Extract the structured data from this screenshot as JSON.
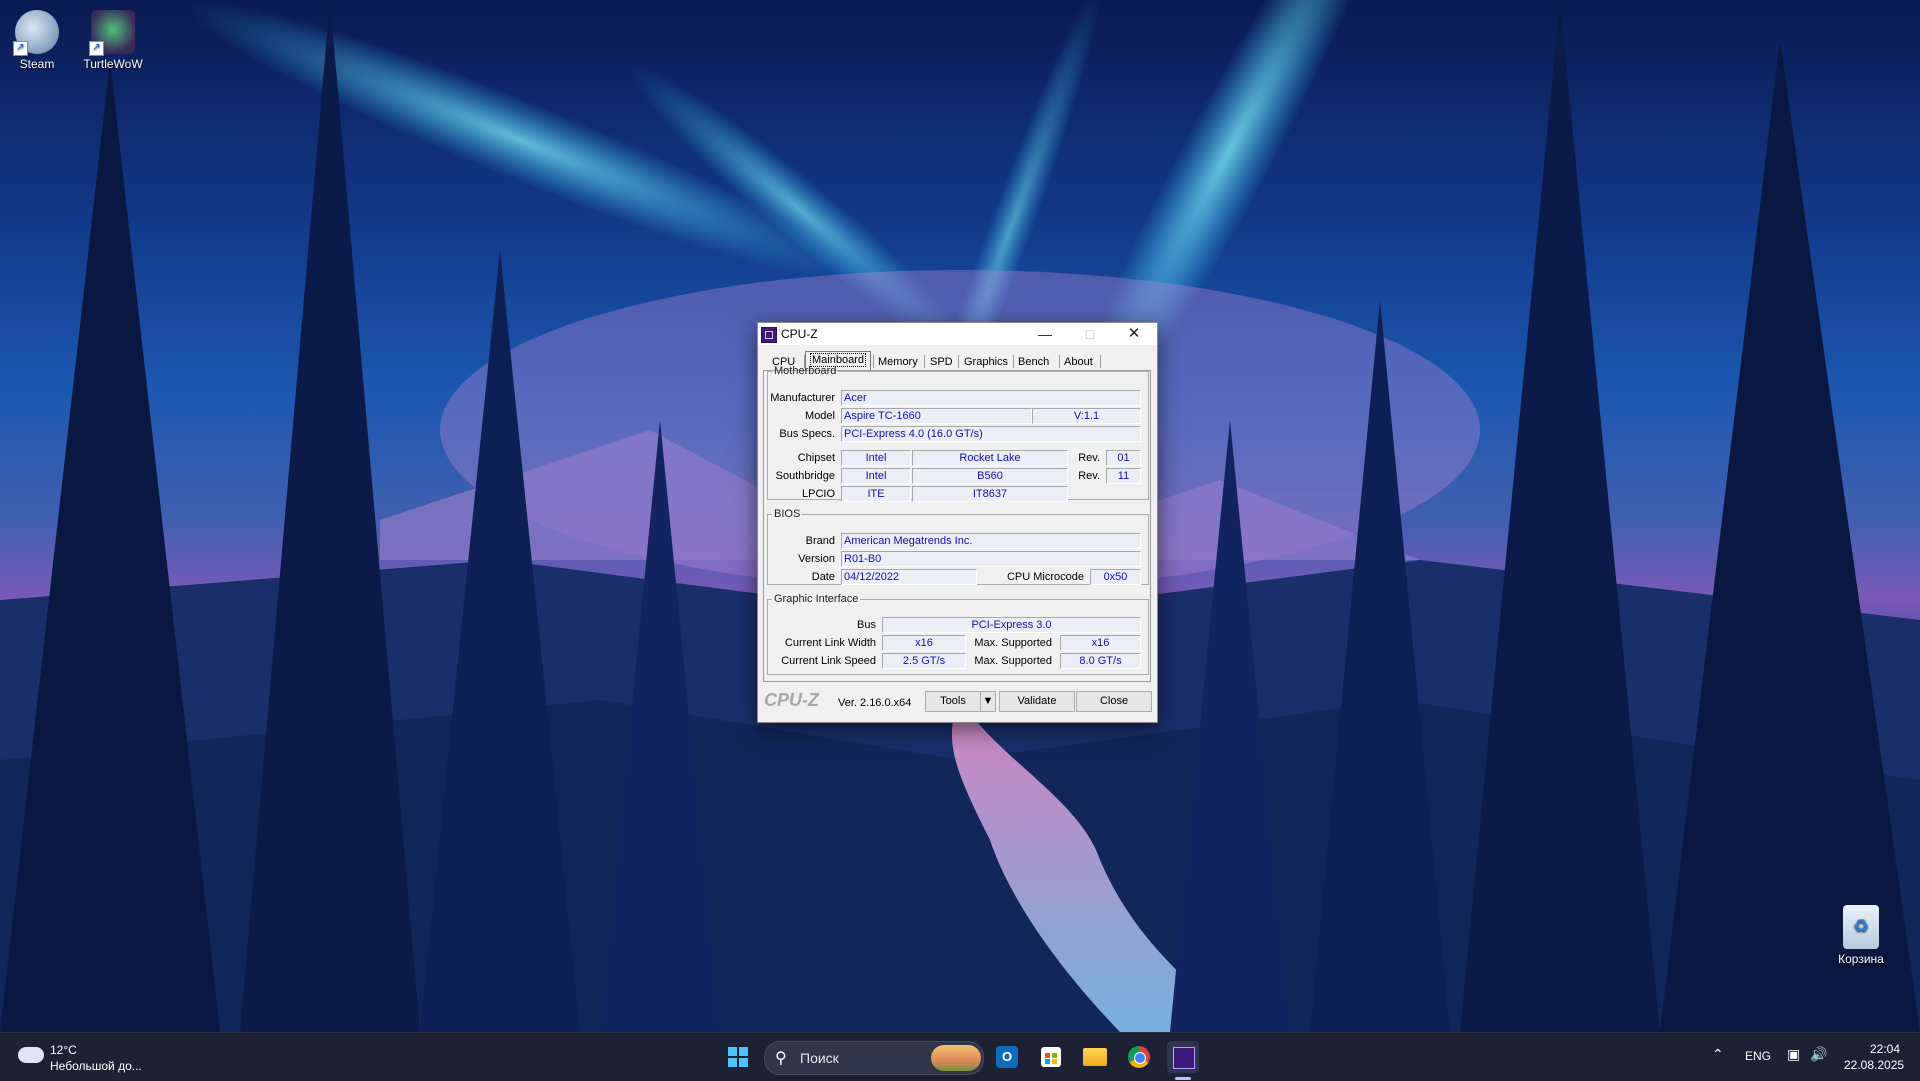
{
  "desktop": {
    "icons": [
      {
        "label": "Steam",
        "icon": "steam-icon"
      },
      {
        "label": "TurtleWoW",
        "icon": "turtlewow-icon"
      },
      {
        "label": "Корзина",
        "icon": "recycle-bin-icon"
      }
    ]
  },
  "cpuz": {
    "title": "CPU-Z",
    "tabs": [
      "CPU",
      "Mainboard",
      "Memory",
      "SPD",
      "Graphics",
      "Bench",
      "About"
    ],
    "selected_tab": "Mainboard",
    "motherboard": {
      "legend": "Motherboard",
      "manufacturer_label": "Manufacturer",
      "manufacturer": "Acer",
      "model_label": "Model",
      "model": "Aspire TC-1660",
      "model_version": "V:1.1",
      "bus_specs_label": "Bus Specs.",
      "bus_specs": "PCI-Express 4.0 (16.0 GT/s)",
      "chipset_label": "Chipset",
      "chipset_vendor": "Intel",
      "chipset_name": "Rocket Lake",
      "chipset_rev_label": "Rev.",
      "chipset_rev": "01",
      "southbridge_label": "Southbridge",
      "southbridge_vendor": "Intel",
      "southbridge_name": "B560",
      "southbridge_rev_label": "Rev.",
      "southbridge_rev": "11",
      "lpcio_label": "LPCIO",
      "lpcio_vendor": "ITE",
      "lpcio_name": "IT8637"
    },
    "bios": {
      "legend": "BIOS",
      "brand_label": "Brand",
      "brand": "American Megatrends Inc.",
      "version_label": "Version",
      "version": "R01-B0",
      "date_label": "Date",
      "date": "04/12/2022",
      "microcode_label": "CPU Microcode",
      "microcode": "0x50"
    },
    "graphic_interface": {
      "legend": "Graphic Interface",
      "bus_label": "Bus",
      "bus": "PCI-Express 3.0",
      "link_width_label": "Current Link Width",
      "link_width": "x16",
      "max_supported_label_1": "Max. Supported",
      "max_width": "x16",
      "link_speed_label": "Current Link Speed",
      "link_speed": "2.5 GT/s",
      "max_supported_label_2": "Max. Supported",
      "max_speed": "8.0 GT/s"
    },
    "footer": {
      "logo": "CPU-Z",
      "version": "Ver. 2.16.0.x64",
      "tools_label": "Tools",
      "validate_label": "Validate",
      "close_label": "Close"
    }
  },
  "taskbar": {
    "weather_temp": "12°C",
    "weather_desc": "Небольшой до...",
    "search_placeholder": "Поиск",
    "language": "ENG",
    "time": "22:04",
    "date": "22.08.2025",
    "apps": [
      "start-icon",
      "outlook-icon",
      "store-icon",
      "file-explorer-icon",
      "chrome-icon",
      "cpuz-taskbar-icon"
    ]
  }
}
